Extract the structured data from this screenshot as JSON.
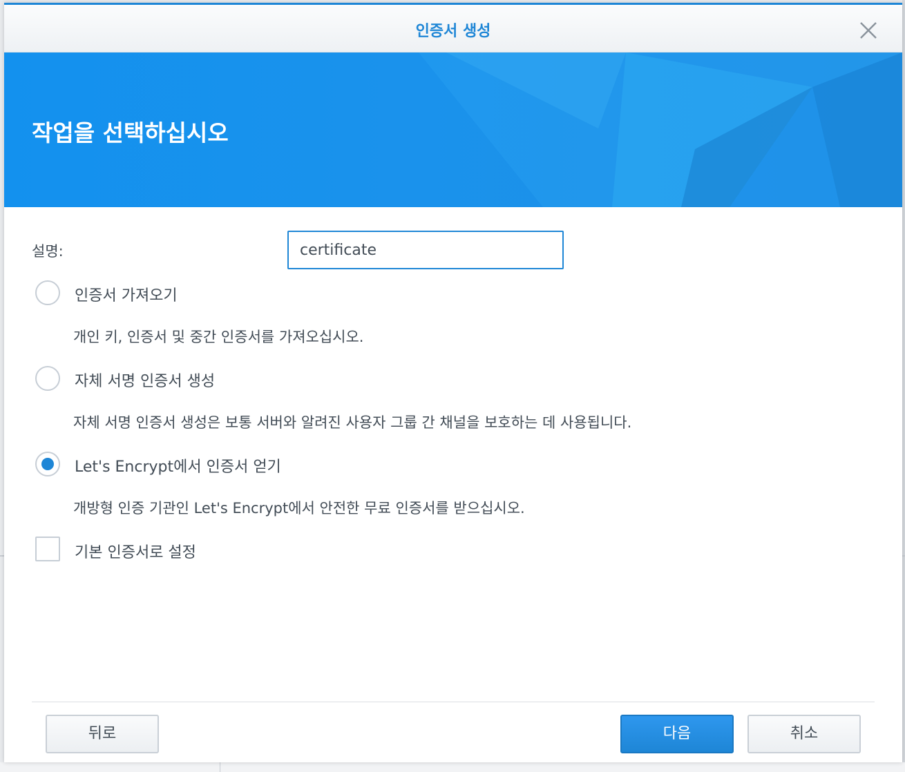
{
  "dialog": {
    "title": "인증서 생성",
    "close_icon": "close-icon",
    "banner_title": "작업을 선택하십시오",
    "accent_color": "#1e86d6"
  },
  "form": {
    "description_label": "설명:",
    "description_value": "certificate",
    "options": [
      {
        "label": "인증서 가져오기",
        "description": "개인 키, 인증서 및 중간 인증서를 가져오십시오.",
        "checked": false
      },
      {
        "label": "자체 서명 인증서 생성",
        "description": "자체 서명 인증서 생성은 보통 서버와 알려진 사용자 그룹 간 채널을 보호하는 데 사용됩니다.",
        "checked": false
      },
      {
        "label": "Let's Encrypt에서 인증서 얻기",
        "description": "개방형 인증 기관인 Let's Encrypt에서 안전한 무료 인증서를 받으십시오.",
        "checked": true
      }
    ],
    "default_checkbox_label": "기본 인증서로 설정",
    "default_checked": false
  },
  "footer": {
    "back_label": "뒤로",
    "next_label": "다음",
    "cancel_label": "취소"
  }
}
